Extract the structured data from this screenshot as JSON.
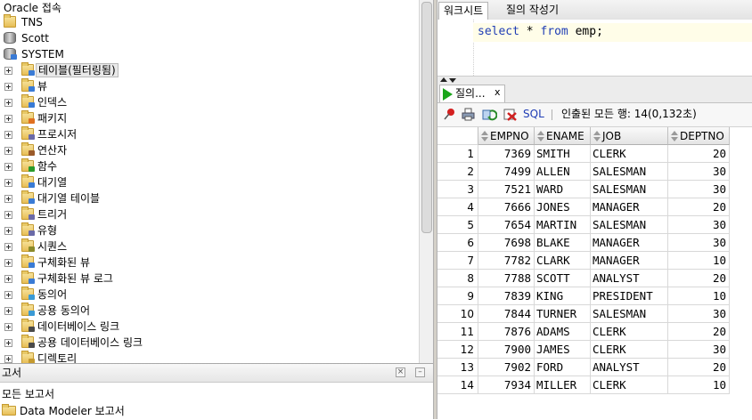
{
  "connections": {
    "root_label": "Oracle 접속",
    "items": [
      {
        "label": "TNS",
        "icon": "folder-icon"
      },
      {
        "label": "Scott",
        "icon": "database-icon"
      },
      {
        "label": "SYSTEM",
        "icon": "database-connected-icon"
      }
    ],
    "system_children": [
      {
        "label": "테이블(필터링됨)",
        "icon": "table-folder-icon",
        "selected": true
      },
      {
        "label": "뷰",
        "icon": "view-folder-icon"
      },
      {
        "label": "인덱스",
        "icon": "index-folder-icon"
      },
      {
        "label": "패키지",
        "icon": "package-folder-icon"
      },
      {
        "label": "프로시저",
        "icon": "procedure-folder-icon"
      },
      {
        "label": "연산자",
        "icon": "operator-folder-icon"
      },
      {
        "label": "함수",
        "icon": "function-folder-icon"
      },
      {
        "label": "대기열",
        "icon": "queue-folder-icon"
      },
      {
        "label": "대기열 테이블",
        "icon": "queue-table-folder-icon"
      },
      {
        "label": "트리거",
        "icon": "trigger-folder-icon"
      },
      {
        "label": "유형",
        "icon": "type-folder-icon"
      },
      {
        "label": "시퀀스",
        "icon": "sequence-folder-icon"
      },
      {
        "label": "구체화된 뷰",
        "icon": "mview-folder-icon"
      },
      {
        "label": "구체화된 뷰 로그",
        "icon": "mview-log-folder-icon"
      },
      {
        "label": "동의어",
        "icon": "synonym-folder-icon"
      },
      {
        "label": "공용 동의어",
        "icon": "public-synonym-folder-icon"
      },
      {
        "label": "데이터베이스 링크",
        "icon": "dblink-folder-icon"
      },
      {
        "label": "공용 데이터베이스 링크",
        "icon": "public-dblink-folder-icon"
      },
      {
        "label": "디렉토리",
        "icon": "directory-folder-icon"
      }
    ]
  },
  "reports": {
    "title": "고서",
    "items": [
      {
        "label": "모든 보고서"
      },
      {
        "label": "Data Modeler 보고서",
        "icon": "folder-open-icon"
      }
    ]
  },
  "worksheet": {
    "tabs": [
      {
        "label": "워크시트",
        "active": true
      },
      {
        "label": "질의 작성기",
        "active": false
      }
    ],
    "sql_keyword_select": "select",
    "sql_star": " * ",
    "sql_keyword_from": "from",
    "sql_rest": " emp;"
  },
  "results": {
    "tab_label": "질의...",
    "tab_close": "x",
    "toolbar": {
      "sql_label": "SQL",
      "status": "인출된 모든 행: 14(0,132초)"
    },
    "columns": [
      "EMPNO",
      "ENAME",
      "JOB",
      "DEPTNO"
    ],
    "rows": [
      [
        "1",
        "7369",
        "SMITH",
        "CLERK",
        "20"
      ],
      [
        "2",
        "7499",
        "ALLEN",
        "SALESMAN",
        "30"
      ],
      [
        "3",
        "7521",
        "WARD",
        "SALESMAN",
        "30"
      ],
      [
        "4",
        "7666",
        "JONES",
        "MANAGER",
        "20"
      ],
      [
        "5",
        "7654",
        "MARTIN",
        "SALESMAN",
        "30"
      ],
      [
        "6",
        "7698",
        "BLAKE",
        "MANAGER",
        "30"
      ],
      [
        "7",
        "7782",
        "CLARK",
        "MANAGER",
        "10"
      ],
      [
        "8",
        "7788",
        "SCOTT",
        "ANALYST",
        "20"
      ],
      [
        "9",
        "7839",
        "KING",
        "PRESIDENT",
        "10"
      ],
      [
        "10",
        "7844",
        "TURNER",
        "SALESMAN",
        "30"
      ],
      [
        "11",
        "7876",
        "ADAMS",
        "CLERK",
        "20"
      ],
      [
        "12",
        "7900",
        "JAMES",
        "CLERK",
        "30"
      ],
      [
        "13",
        "7902",
        "FORD",
        "ANALYST",
        "20"
      ],
      [
        "14",
        "7934",
        "MILLER",
        "CLERK",
        "10"
      ]
    ]
  },
  "colors": {
    "sql_keyword": "#1f3db5",
    "editor_current_line": "#fffde8",
    "run_green": "#1aa51a"
  }
}
